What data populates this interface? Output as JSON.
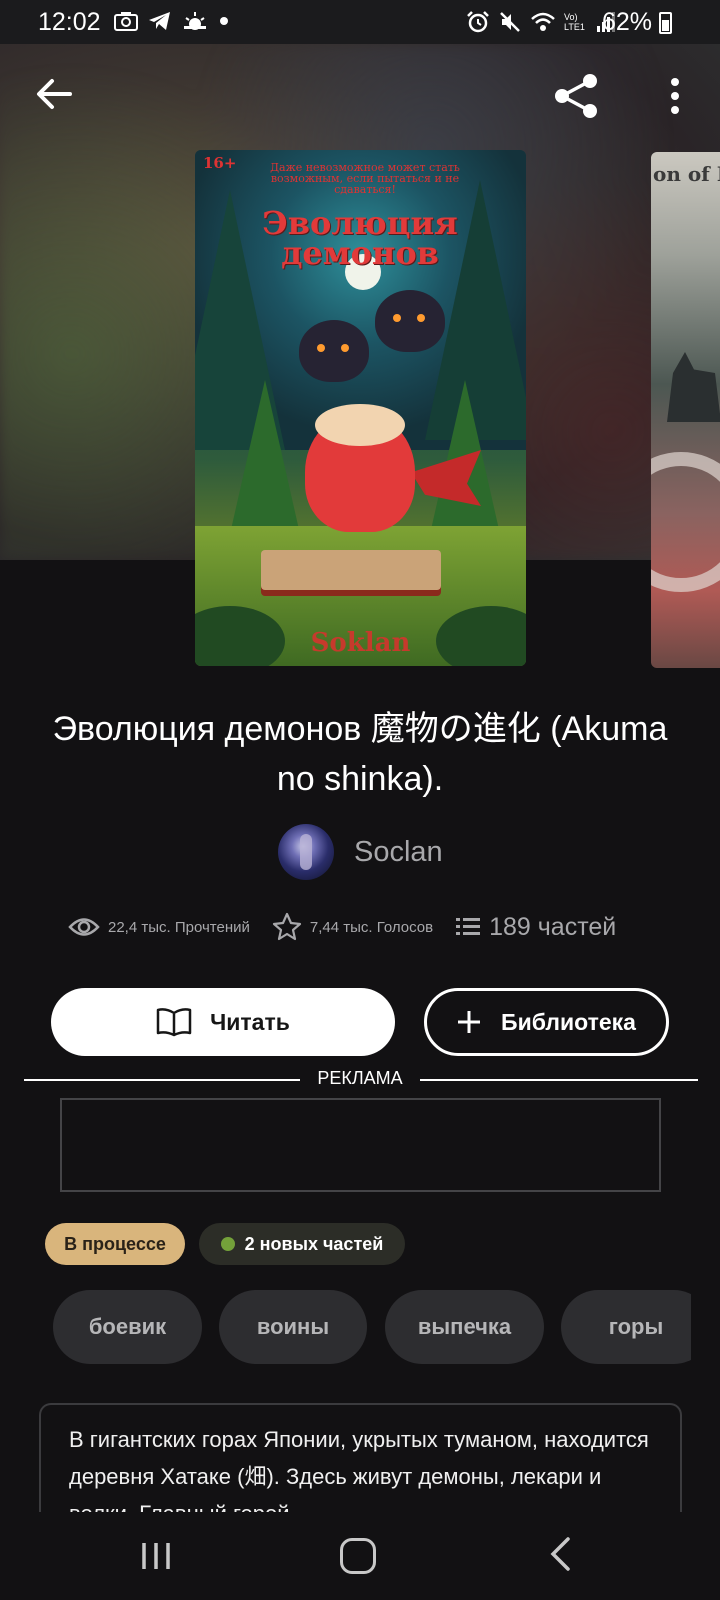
{
  "status_bar": {
    "time": "12:02",
    "battery": "62%",
    "network": "Vo) LTE1"
  },
  "header": {
    "back_icon": "arrow-left-icon",
    "share_icon": "share-icon",
    "more_icon": "more-vertical-icon"
  },
  "cover": {
    "age_rating": "16+",
    "tagline": "Даже невозможное может стать возможным, если пытаться и не сдаваться!",
    "title": "Эволюция демонов",
    "author": "Soklan"
  },
  "next_cover": {
    "title": "on of D"
  },
  "book": {
    "title": "Эволюция демонов 魔物の進化 (Akuma no shinka).",
    "author": "Soclan"
  },
  "stats": {
    "reads": "22,4 тыс. Прочтений",
    "votes": "7,44 тыс. Голосов",
    "parts": "189 частей"
  },
  "actions": {
    "read_label": "Читать",
    "library_label": "Библиотека"
  },
  "ad": {
    "label": "РЕКЛАМА"
  },
  "status_chip": "В процессе",
  "new_parts_chip": "2 новых частей",
  "colors": {
    "background": "#121113",
    "status_chip": "#d9b57c",
    "new_dot": "#74a13a",
    "tag_bg": "#2d2d30"
  },
  "tags": [
    "боевик",
    "воины",
    "выпечка",
    "горы"
  ],
  "description": "В гигантских горах Японии, укрытых туманом, находится деревня Хатаке (畑). Здесь живут демоны, лекари и волки. Главный герой"
}
